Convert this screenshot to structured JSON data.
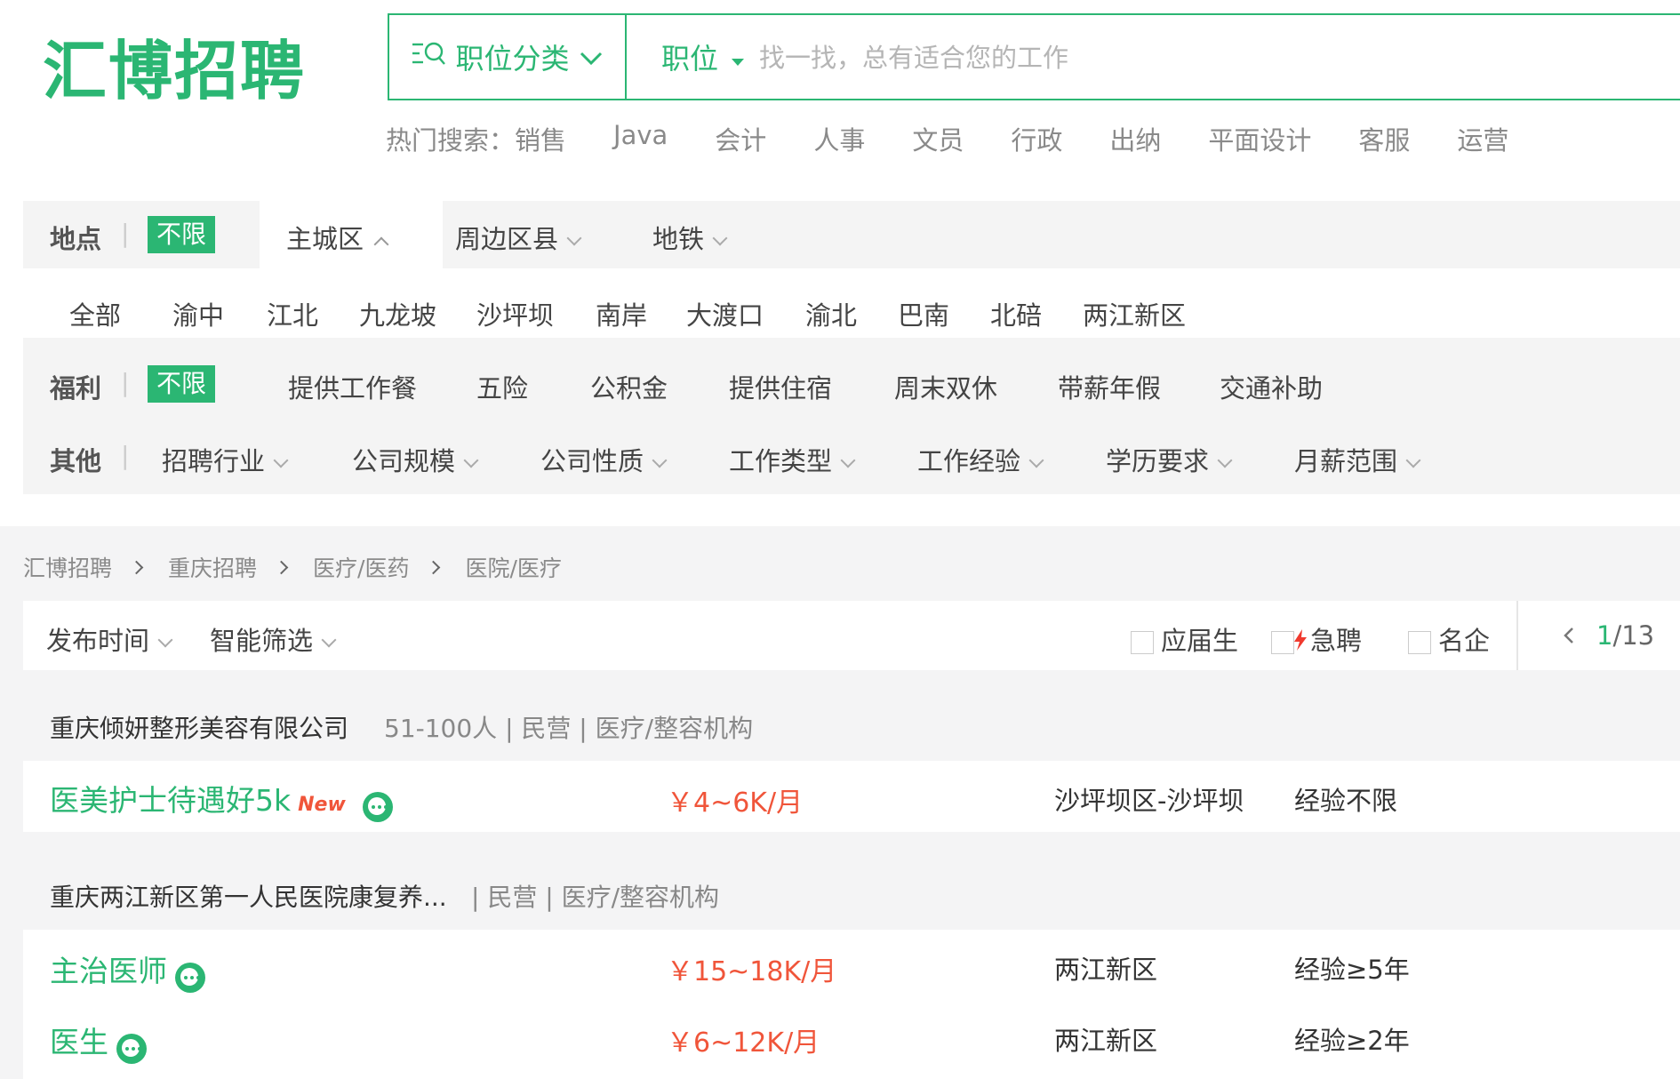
{
  "header": {
    "logo": "汇博招聘",
    "category_button": "职位分类",
    "field_select": "职位",
    "search_placeholder": "找一找，总有适合您的工作",
    "hot_label": "热门搜索：",
    "hot_keywords": [
      "销售",
      "Java",
      "会计",
      "人事",
      "文员",
      "行政",
      "出纳",
      "平面设计",
      "客服",
      "运营"
    ]
  },
  "filters": {
    "location": {
      "label": "地点",
      "unlimited": "不限",
      "tabs": [
        "主城区",
        "周边区县",
        "地铁"
      ],
      "districts": [
        "全部",
        "渝中",
        "江北",
        "九龙坡",
        "沙坪坝",
        "南岸",
        "大渡口",
        "渝北",
        "巴南",
        "北碚",
        "两江新区"
      ]
    },
    "benefits": {
      "label": "福利",
      "unlimited": "不限",
      "items": [
        "提供工作餐",
        "五险",
        "公积金",
        "提供住宿",
        "周末双休",
        "带薪年假",
        "交通补助"
      ]
    },
    "other": {
      "label": "其他",
      "items": [
        "招聘行业",
        "公司规模",
        "公司性质",
        "工作类型",
        "工作经验",
        "学历要求",
        "月薪范围"
      ]
    }
  },
  "breadcrumb": [
    "汇博招聘",
    "重庆招聘",
    "医疗/医药",
    "医院/医疗"
  ],
  "sortbar": {
    "sort_time": "发布时间",
    "smart_filter": "智能筛选",
    "chk_graduate": "应届生",
    "chk_urgent": "急聘",
    "chk_famous": "名企",
    "page": "1",
    "page_total": "/13"
  },
  "companies": [
    {
      "name": "重庆倾妍整形美容有限公司",
      "meta": "51-100人 | 民营 | 医疗/整容机构",
      "jobs": [
        {
          "title": "医美护士待遇好5k",
          "new": "New",
          "salary": "￥4~6K/月",
          "location": "沙坪坝区-沙坪坝",
          "experience": "经验不限"
        }
      ]
    },
    {
      "name": "重庆两江新区第一人民医院康复养...",
      "meta": "| 民营 | 医疗/整容机构",
      "jobs": [
        {
          "title": "主治医师",
          "salary": "￥15~18K/月",
          "location": "两江新区",
          "experience": "经验≥5年"
        },
        {
          "title": "医生",
          "salary": "￥6~12K/月",
          "location": "两江新区",
          "experience": "经验≥2年"
        }
      ]
    }
  ],
  "colors": {
    "brand": "#2bb673",
    "salary": "#f0553a",
    "panel": "#f4f4f4"
  }
}
